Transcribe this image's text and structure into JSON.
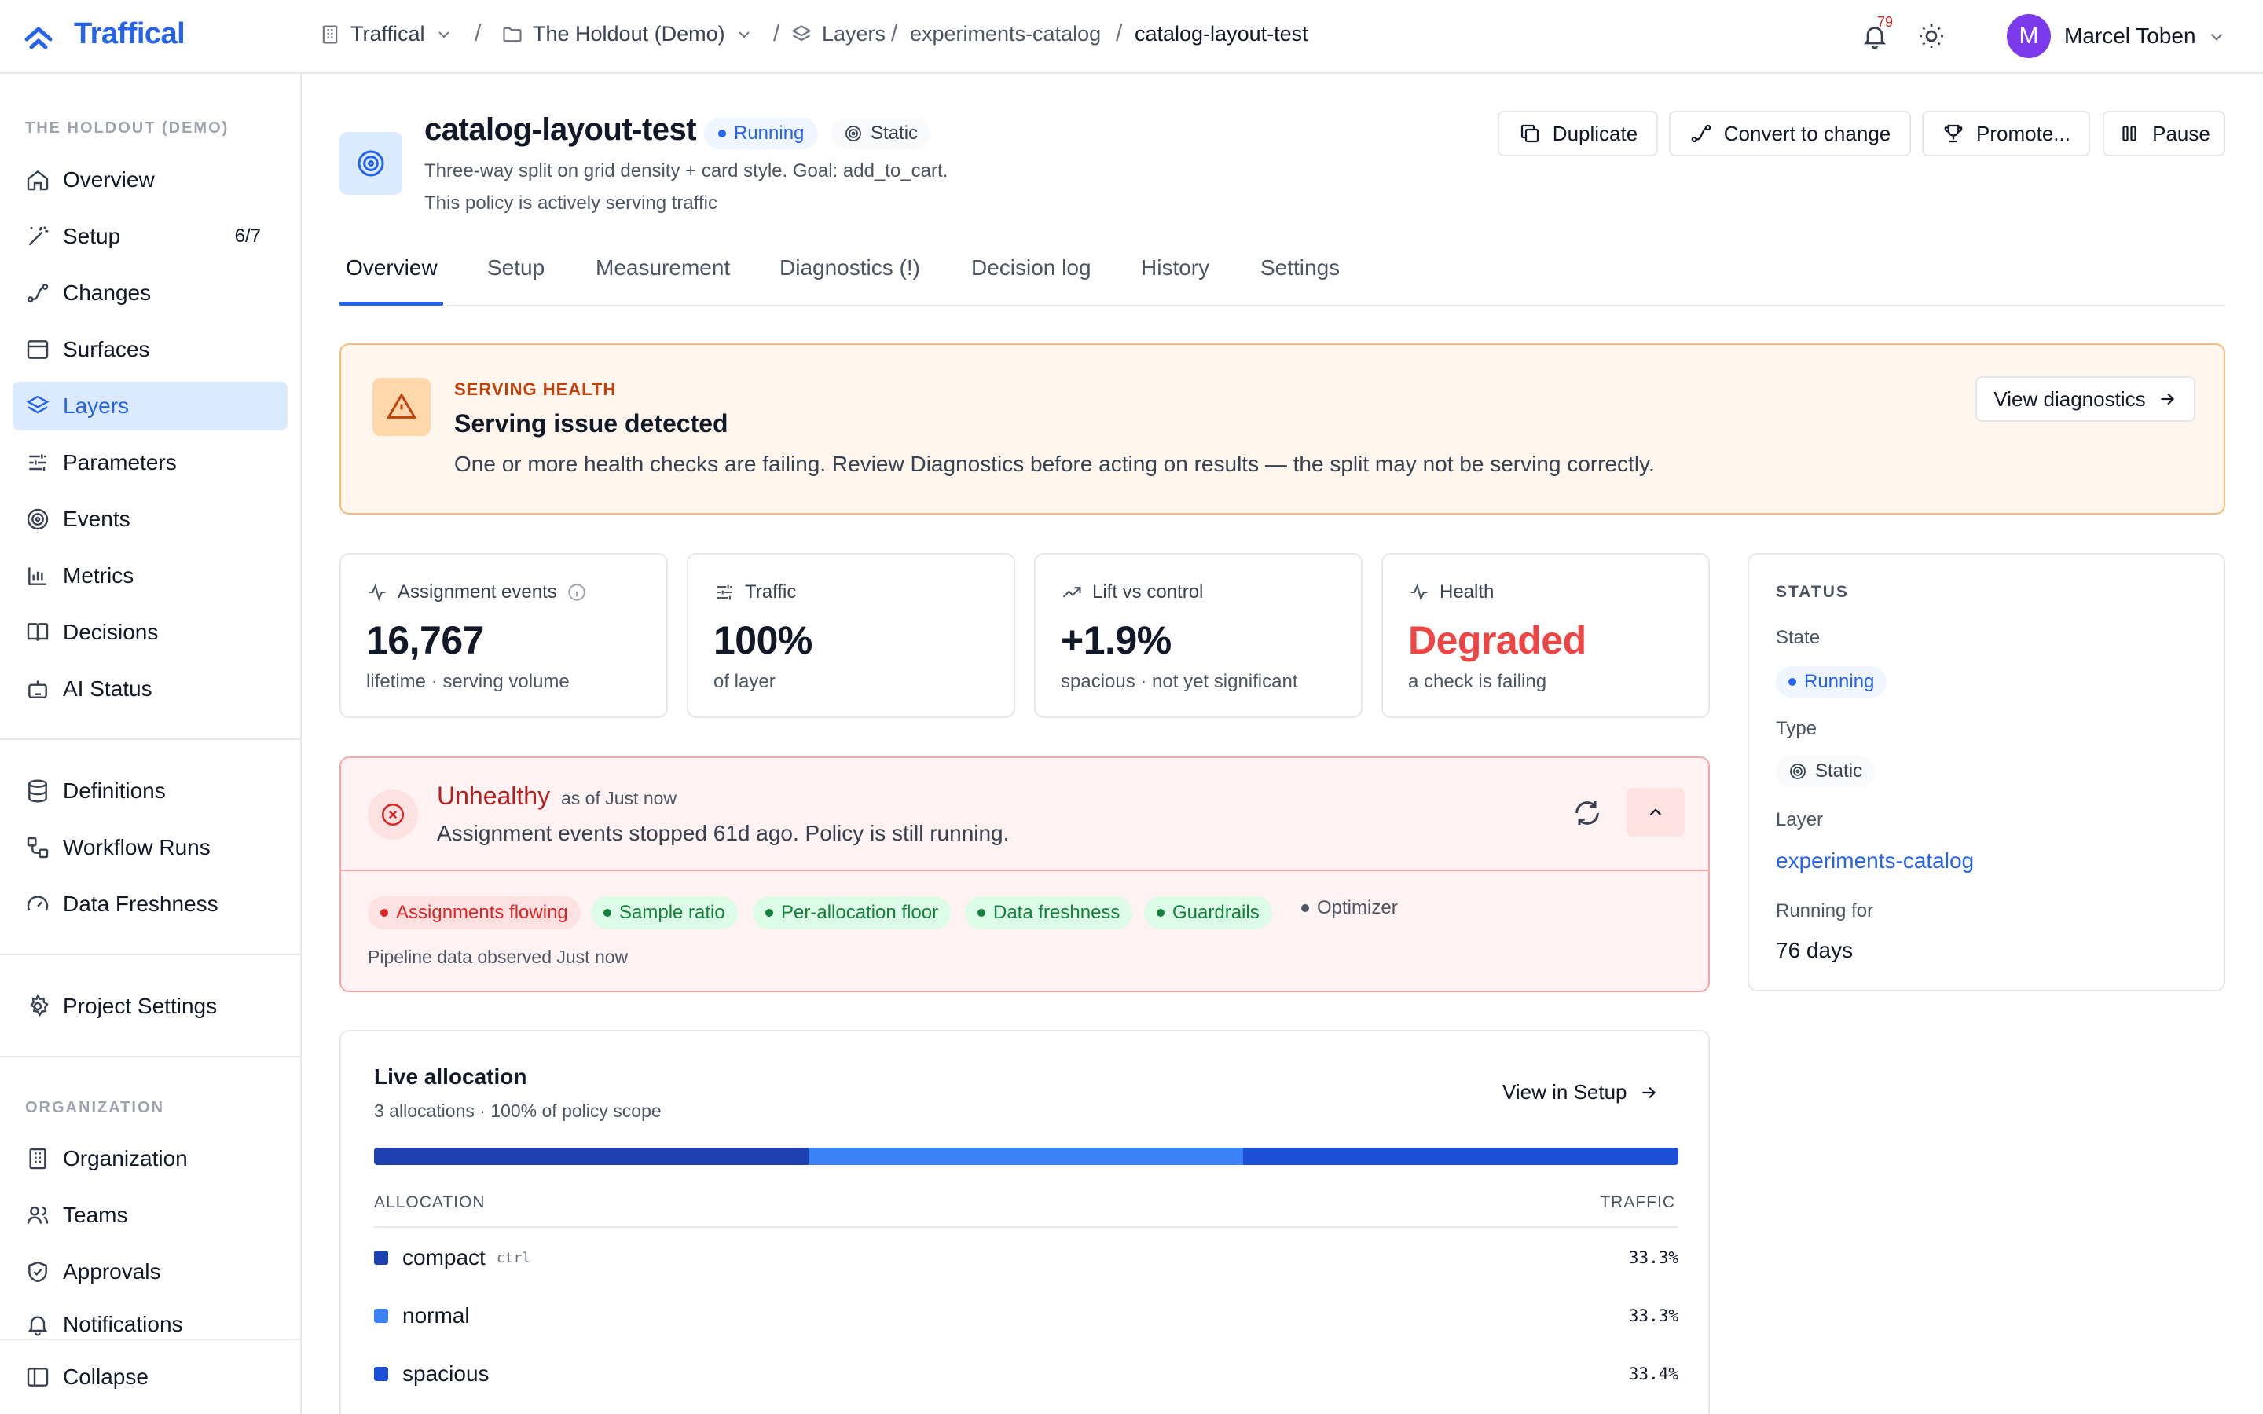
{
  "app": {
    "brand": "Traffical"
  },
  "breadcrumb": {
    "org": "Traffical",
    "project": "The Holdout (Demo)",
    "section": "Layers",
    "layer": "experiments-catalog",
    "current": "catalog-layout-test",
    "separator": "/"
  },
  "topbar": {
    "notifications_count": "79",
    "user_initial": "M",
    "user_name": "Marcel Toben"
  },
  "sidebar": {
    "project_section": "THE HOLDOUT (DEMO)",
    "items": [
      {
        "label": "Overview",
        "icon": "home-icon"
      },
      {
        "label": "Setup",
        "icon": "wand-icon",
        "count": "6/7"
      },
      {
        "label": "Changes",
        "icon": "route-icon"
      },
      {
        "label": "Surfaces",
        "icon": "browser-icon"
      },
      {
        "label": "Layers",
        "icon": "layers-icon",
        "active": true
      },
      {
        "label": "Parameters",
        "icon": "sliders-icon"
      },
      {
        "label": "Events",
        "icon": "target-icon"
      },
      {
        "label": "Metrics",
        "icon": "bar-chart-icon"
      },
      {
        "label": "Decisions",
        "icon": "book-icon"
      },
      {
        "label": "AI Status",
        "icon": "robot-icon"
      }
    ],
    "data_items": [
      {
        "label": "Definitions",
        "icon": "database-icon"
      },
      {
        "label": "Workflow Runs",
        "icon": "workflow-icon"
      },
      {
        "label": "Data Freshness",
        "icon": "gauge-icon"
      }
    ],
    "settings_item": {
      "label": "Project Settings",
      "icon": "gear-icon"
    },
    "org_section": "ORGANIZATION",
    "org_items": [
      {
        "label": "Organization",
        "icon": "building-icon"
      },
      {
        "label": "Teams",
        "icon": "users-icon"
      },
      {
        "label": "Approvals",
        "icon": "shield-check-icon"
      },
      {
        "label": "Notifications",
        "icon": "bell-icon"
      }
    ],
    "collapse_label": "Collapse"
  },
  "policy": {
    "name": "catalog-layout-test",
    "status": "Running",
    "type": "Static",
    "description": "Three-way split on grid density + card style. Goal: add_to_cart.",
    "subtitle": "This policy is actively serving traffic"
  },
  "actions": {
    "duplicate": "Duplicate",
    "convert": "Convert to change",
    "promote": "Promote...",
    "pause": "Pause"
  },
  "tabs": [
    "Overview",
    "Setup",
    "Measurement",
    "Diagnostics (!)",
    "Decision log",
    "History",
    "Settings"
  ],
  "alert": {
    "eyebrow": "SERVING HEALTH",
    "title": "Serving issue detected",
    "text": "One or more health checks are failing. Review Diagnostics before acting on results — the split may not be serving correctly.",
    "button": "View diagnostics"
  },
  "stats": [
    {
      "label": "Assignment events",
      "value": "16,767",
      "sub": "lifetime · serving volume"
    },
    {
      "label": "Traffic",
      "value": "100%",
      "sub": "of layer"
    },
    {
      "label": "Lift vs control",
      "value": "+1.9%",
      "sub": "spacious · not yet significant"
    },
    {
      "label": "Health",
      "value": "Degraded",
      "sub": "a check is failing"
    }
  ],
  "status_card": {
    "heading": "STATUS",
    "state_label": "State",
    "state_value": "Running",
    "type_label": "Type",
    "type_value": "Static",
    "layer_label": "Layer",
    "layer_value": "experiments-catalog",
    "running_label": "Running for",
    "running_value": "76 days"
  },
  "health": {
    "title": "Unhealthy",
    "as_of": "as of Just now",
    "text": "Assignment events stopped 61d ago. Policy is still running.",
    "checks": [
      {
        "label": "Assignments flowing",
        "state": "fail"
      },
      {
        "label": "Sample ratio",
        "state": "pass"
      },
      {
        "label": "Per-allocation floor",
        "state": "pass"
      },
      {
        "label": "Data freshness",
        "state": "pass"
      },
      {
        "label": "Guardrails",
        "state": "pass"
      },
      {
        "label": "Optimizer",
        "state": "neutral"
      }
    ],
    "footer": "Pipeline data observed Just now"
  },
  "allocation": {
    "title": "Live allocation",
    "subtitle": "3 allocations · 100% of policy scope",
    "view_link": "View in Setup",
    "col_allocation": "ALLOCATION",
    "col_traffic": "TRAFFIC",
    "rows": [
      {
        "name": "compact",
        "tag": "ctrl",
        "traffic": "33.3%",
        "share": 33.3,
        "color": "#1e40af"
      },
      {
        "name": "normal",
        "tag": "",
        "traffic": "33.3%",
        "share": 33.3,
        "color": "#3b82f6"
      },
      {
        "name": "spacious",
        "tag": "",
        "traffic": "33.4%",
        "share": 33.4,
        "color": "#1d4ed8"
      }
    ]
  },
  "colors": {
    "accent": "#2563eb",
    "warning": "#c2410c",
    "danger": "#dc2626",
    "success": "#15803d"
  }
}
